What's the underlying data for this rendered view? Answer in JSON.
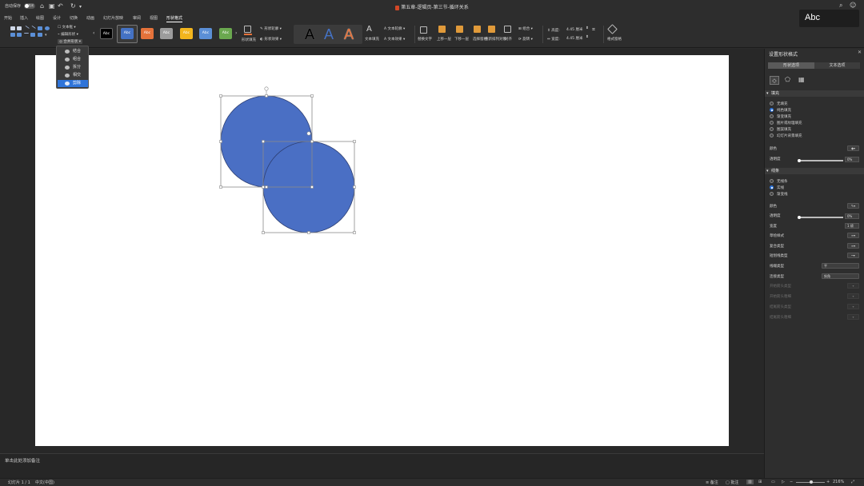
{
  "titlebar": {
    "autosave_label": "自动保存",
    "autosave_state": "关闭",
    "document_title": "第五章-逻辑页-第三节-循环关系"
  },
  "menu": {
    "tabs": [
      "开始",
      "插入",
      "绘图",
      "设计",
      "切换",
      "动画",
      "幻灯片放映",
      "审阅",
      "视图",
      "形状格式"
    ],
    "active": "形状格式"
  },
  "ribbon": {
    "text_box": "文本框",
    "edit_shape": "编辑形状",
    "merge_shapes": "合并形状",
    "style_sample": "Abc",
    "shape_fill": "形状填充",
    "shape_outline": "形状轮廓",
    "shape_effects": "形状效果",
    "text_fill": "文本填充",
    "text_outline": "文本轮廓",
    "text_effects": "文本效果",
    "alt_text": "替换文字",
    "bring_forward": "上移一层",
    "send_backward": "下移一层",
    "selection_pane": "选择窗格",
    "reorder": "重新排列对象",
    "align": "对齐",
    "group": "组合",
    "rotate": "旋转",
    "height_label": "高度:",
    "height_value": "4.45 厘米",
    "width_label": "宽度:",
    "width_value": "4.45 厘米",
    "format_pane": "格式窗格"
  },
  "merge_menu": {
    "items": [
      "结合",
      "组合",
      "拆分",
      "相交",
      "剪除"
    ],
    "selected": "剪除"
  },
  "canvas": {
    "shape_color": "#4a6fc4",
    "shape_outline": "#2d3f73"
  },
  "notes": {
    "placeholder": "单击此处添加备注"
  },
  "statusbar": {
    "slide_info": "幻灯片 1 / 1",
    "language": "中文(中国)",
    "notes_btn": "备注",
    "comments_btn": "批注",
    "zoom": "216%"
  },
  "pane": {
    "title": "设置形状格式",
    "tab_shape": "形状选项",
    "tab_text": "文本选项",
    "fill_section": "填充",
    "fill_options": [
      "无填充",
      "纯色填充",
      "渐变填充",
      "图片或纹理填充",
      "图案填充",
      "幻灯片背景填充"
    ],
    "fill_selected": 1,
    "color_label": "颜色",
    "transparency_label": "透明度",
    "transparency_value": "0%",
    "line_section": "线条",
    "line_options": [
      "无线条",
      "实线",
      "渐变线"
    ],
    "line_selected": 1,
    "line_color_label": "颜色",
    "line_transparency_label": "透明度",
    "line_transparency_value": "0%",
    "width_label": "宽度",
    "width_value": "1 磅",
    "sketch_label": "草绘样式",
    "compound_label": "复合类型",
    "dash_label": "短划线类型",
    "cap_label": "线端类型",
    "cap_value": "平",
    "join_label": "连接类型",
    "join_value": "斜角",
    "begin_arrow_type": "开始箭头类型",
    "begin_arrow_size": "开始箭头粗细",
    "end_arrow_type": "结尾箭头类型",
    "end_arrow_size": "结尾箭头粗细"
  },
  "tooltip": {
    "text": "Abc"
  }
}
